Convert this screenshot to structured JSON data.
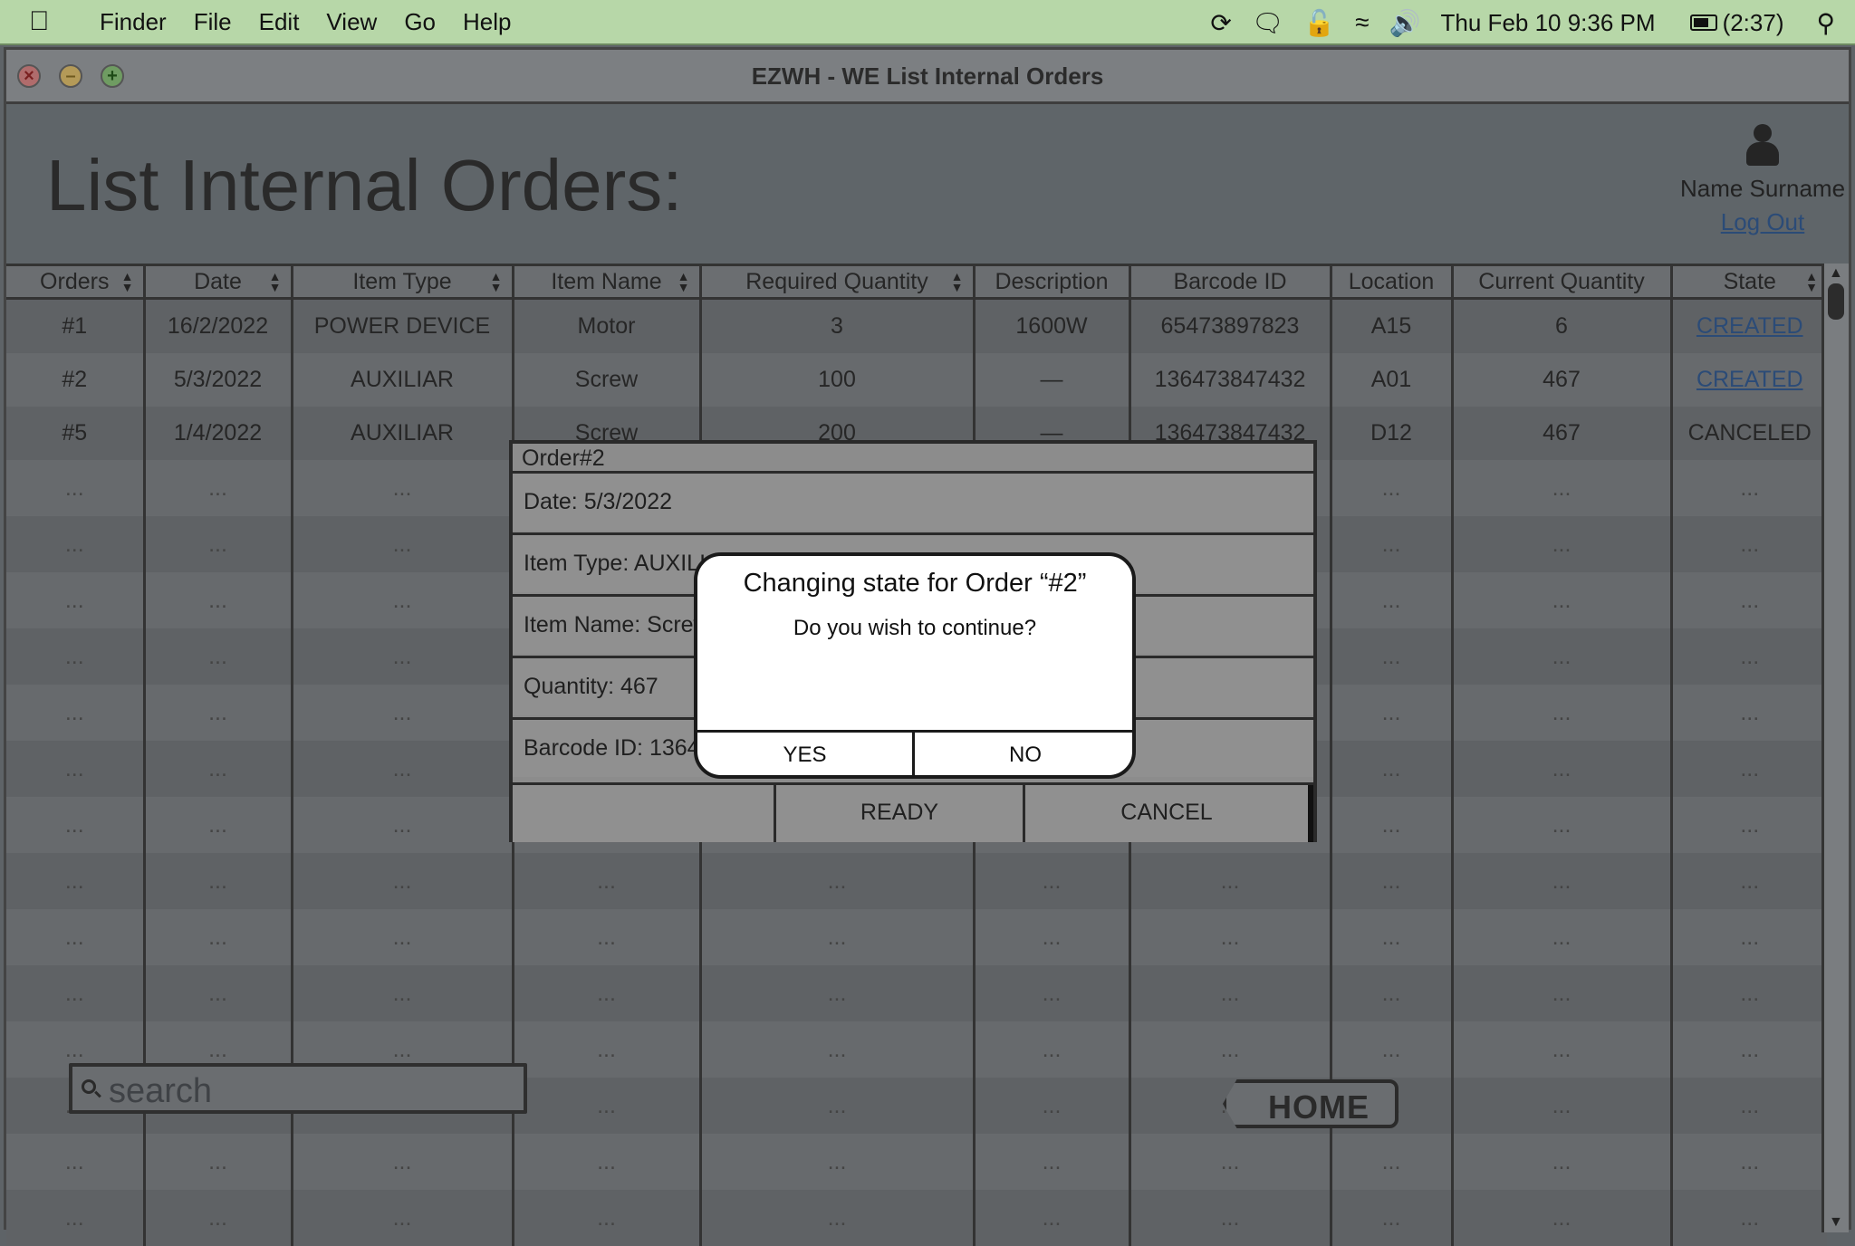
{
  "menubar": {
    "menus": [
      "Finder",
      "File",
      "Edit",
      "View",
      "Go",
      "Help"
    ],
    "clock": "Thu Feb 10  9:36 PM",
    "battery": "(2:37)",
    "icons": [
      "sync-icon",
      "chat-icon",
      "lock-icon",
      "wifi-icon",
      "volume-icon",
      "search-icon"
    ]
  },
  "window": {
    "title": "EZWH - WE List Internal Orders"
  },
  "header": {
    "page_title": "List Internal Orders:",
    "user_name": "Name Surname",
    "logout_label": "Log Out"
  },
  "table": {
    "columns": [
      "Orders",
      "Date",
      "Item Type",
      "Item Name",
      "Required Quantity",
      "Description",
      "Barcode ID",
      "Location",
      "Current Quantity",
      "State"
    ],
    "rows": [
      [
        "#1",
        "16/2/2022",
        "POWER DEVICE",
        "Motor",
        "3",
        "1600W",
        "65473897823",
        "A15",
        "6",
        "CREATED"
      ],
      [
        "#2",
        "5/3/2022",
        "AUXILIAR",
        "Screw",
        "100",
        "—",
        "136473847432",
        "A01",
        "467",
        "CREATED"
      ],
      [
        "#5",
        "1/4/2022",
        "AUXILIAR",
        "Screw",
        "200",
        "—",
        "136473847432",
        "D12",
        "467",
        "CANCELED"
      ]
    ],
    "placeholder": "..."
  },
  "search": {
    "placeholder": "search"
  },
  "home": {
    "label": "HOME"
  },
  "order_panel": {
    "title": "Order#2",
    "date": "Date: 5/3/2022",
    "item_type": "Item Type: AUXILIAR",
    "item_name": "Item Name: Screw",
    "quantity": "Quantity: 467",
    "barcode": "Barcode ID: 136473847432",
    "ready_label": "READY",
    "cancel_label": "CANCEL"
  },
  "confirm": {
    "title": "Changing state for Order “#2”",
    "message": "Do you wish to continue?",
    "yes_label": "YES",
    "no_label": "NO"
  }
}
